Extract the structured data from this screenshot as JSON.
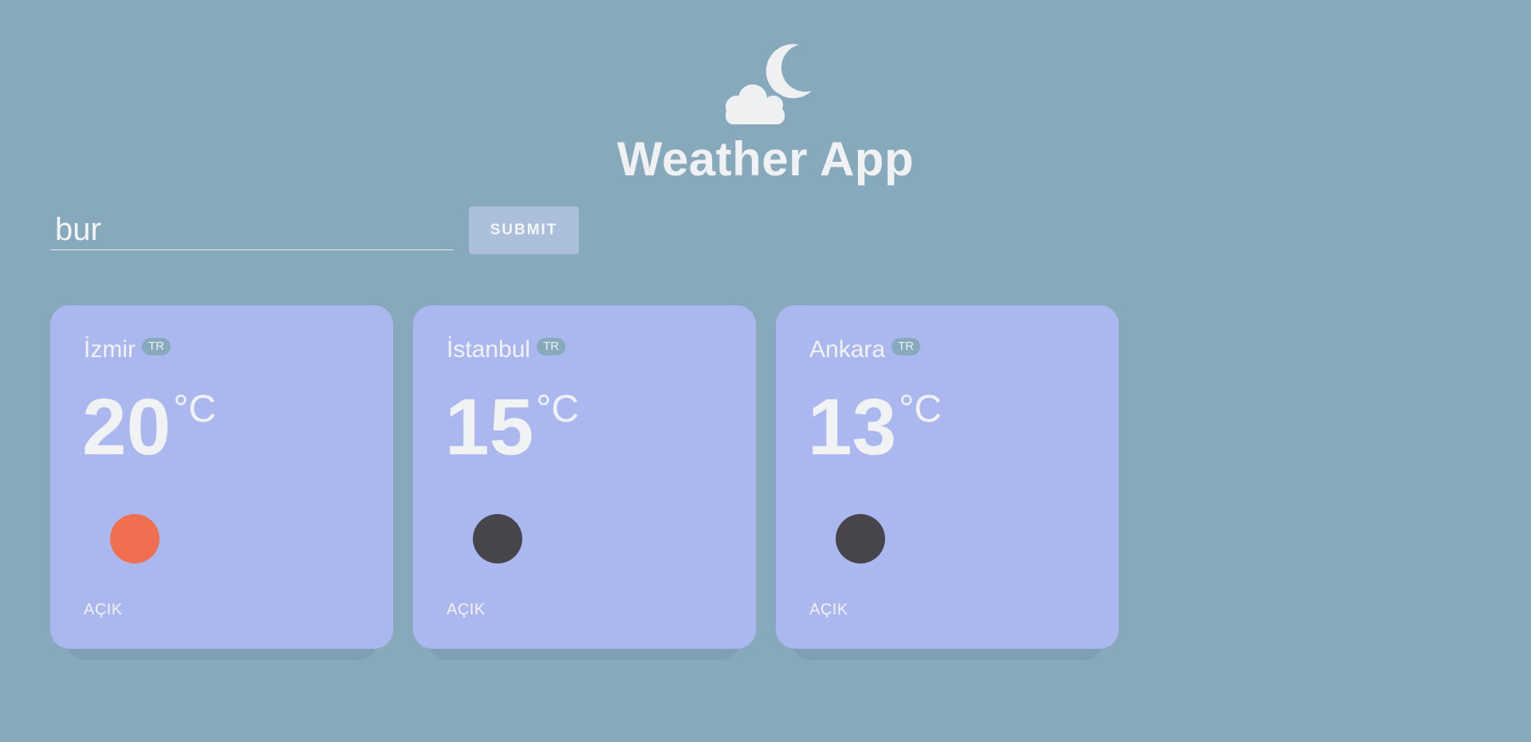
{
  "header": {
    "title": "Weather App",
    "logo_icon": "cloud-moon-icon"
  },
  "search": {
    "value": "bur",
    "placeholder": "",
    "submit_label": "SUBMIT"
  },
  "colors": {
    "background": "#87a9bc",
    "card": "#abb7ef",
    "button": "#abbfdb",
    "sun_icon": "#ef6f50",
    "moon_icon": "#474549"
  },
  "cards": [
    {
      "city": "İzmir",
      "country": "TR",
      "temp": "20",
      "unit": "°C",
      "icon": "sun-icon",
      "icon_color": "#ef6f50",
      "condition": "AÇIK"
    },
    {
      "city": "İstanbul",
      "country": "TR",
      "temp": "15",
      "unit": "°C",
      "icon": "moon-icon",
      "icon_color": "#474549",
      "condition": "AÇIK"
    },
    {
      "city": "Ankara",
      "country": "TR",
      "temp": "13",
      "unit": "°C",
      "icon": "moon-icon",
      "icon_color": "#474549",
      "condition": "AÇIK"
    }
  ]
}
